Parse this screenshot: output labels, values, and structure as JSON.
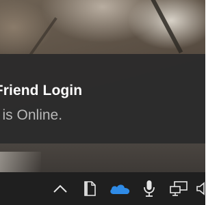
{
  "notification": {
    "title": "at Friend Login",
    "body": "o is Online."
  },
  "taskbar": {
    "tray_icons": [
      "chevron-up-icon",
      "document-icon",
      "onedrive-cloud-icon",
      "microphone-icon",
      "network-icon",
      "speaker-icon"
    ]
  },
  "colors": {
    "toast_background": "#2b2b2b",
    "toast_title": "#ffffff",
    "toast_body": "#b9b9b9",
    "taskbar_background": "#1f1f1f",
    "onedrive_blue": "#2f8be6"
  }
}
